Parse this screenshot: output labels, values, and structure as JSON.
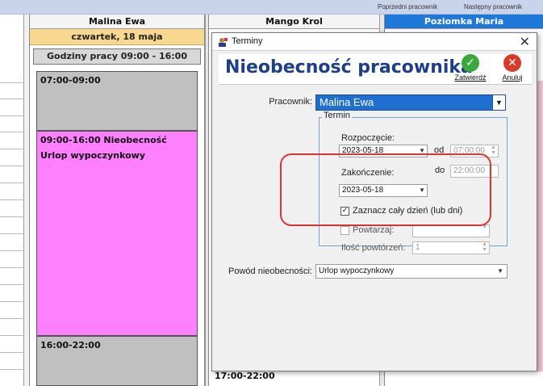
{
  "top_nav": {
    "prev_label": "Poprzedni pracownik",
    "next_label": "Następny pracownik"
  },
  "calendar": {
    "columns": [
      {
        "name": "Malina Ewa",
        "date": "czwartek, 18 maja",
        "hours": "Godziny pracy 09:00 - 16:00",
        "slots": [
          {
            "time": "07:00-09:00",
            "detail": "",
            "type": "grey"
          },
          {
            "time": "09:00-16:00 Nieobecność",
            "detail": "Urlop wypoczynkowy",
            "type": "pink"
          },
          {
            "time": "16:00-22:00",
            "detail": "",
            "type": "grey"
          }
        ]
      },
      {
        "name": "Mango Krol",
        "slots": [
          {
            "time": "17:00-22:00",
            "detail": "",
            "type": "grey"
          }
        ]
      },
      {
        "name": "Poziomka Maria"
      }
    ]
  },
  "dialog": {
    "window_title": "Terminy",
    "close_glyph": "✕",
    "heading": "Nieobecność pracownika",
    "confirm_label": "Zatwierdź",
    "cancel_label": "Anuluj",
    "employee_label": "Pracownik:",
    "employee_value": "Malina Ewa",
    "term_legend": "Termin",
    "start_label": "Rozpoczęcie:",
    "start_date": "2023-05-18",
    "from_label": "od",
    "start_time": "07:00:00",
    "end_label": "Zakończenie:",
    "to_label": "do",
    "end_time": "22:00:00",
    "end_date": "2023-05-18",
    "whole_day_label": "Zaznacz cały dzień (lub dni)",
    "whole_day_checked": true,
    "repeat_label": "Powtarzaj:",
    "repeat_count_label": "Ilość powtórzeń:",
    "repeat_count_value": "1",
    "reason_label": "Powód nieobecności:",
    "reason_value": "Urlop wypoczynkowy"
  },
  "colors": {
    "selected_column": "#1e78d8",
    "date_header": "#f8d890",
    "absence_slot": "#ff80ff",
    "busy_slot": "#c0c0c0",
    "dialog_title": "#1d3f8a",
    "highlight": "#e03232",
    "confirm_icon": "#3aa83a",
    "cancel_icon": "#d83a2a"
  },
  "icons": {
    "confirm": "check-circle-icon",
    "cancel": "x-circle-icon",
    "app": "app-person-icon",
    "dropdown": "chevron-down-icon"
  }
}
